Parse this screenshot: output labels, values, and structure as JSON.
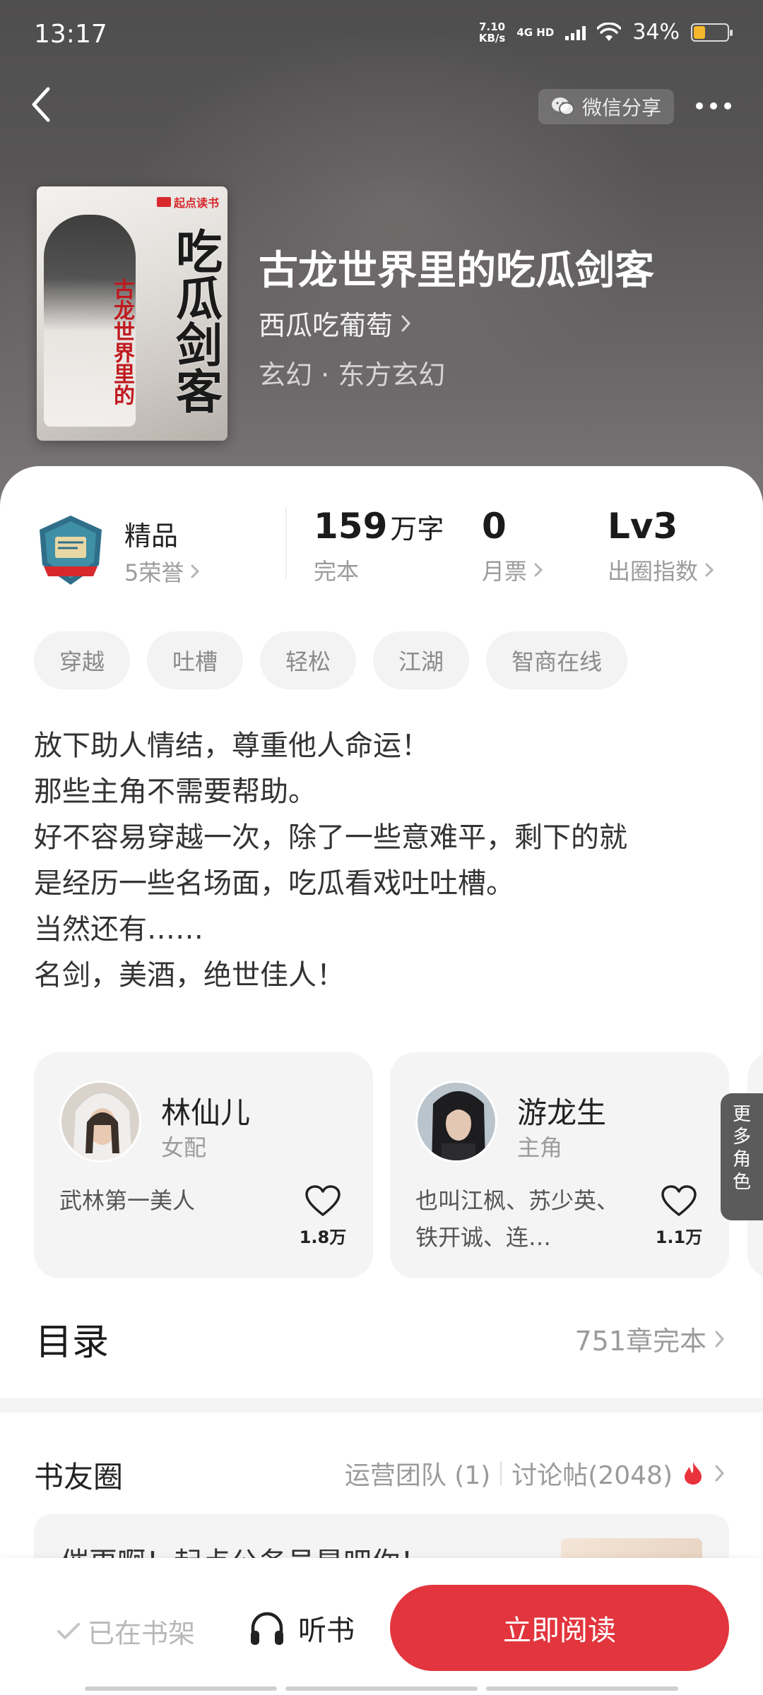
{
  "status_bar": {
    "time": "13:17",
    "net_speed_value": "7.10",
    "net_speed_unit": "KB/s",
    "network": "4G HD",
    "battery": "34%",
    "battery_level": 0.34
  },
  "header": {
    "share_label": "微信分享"
  },
  "book": {
    "cover": {
      "publisher_tag": "起点读书",
      "title_big": "吃瓜剑客",
      "title_red": "古龙世界里的"
    },
    "title": "古龙世界里的吃瓜剑客",
    "author": "西瓜吃葡萄",
    "genre": "玄幻 · 东方玄幻"
  },
  "stats": {
    "honor": {
      "title": "精品",
      "sub": "5荣誉"
    },
    "words": {
      "num": "159",
      "unit": "万字",
      "label": "完本"
    },
    "monthly": {
      "num": "0",
      "label": "月票"
    },
    "influence": {
      "num": "Lv3",
      "label": "出圈指数"
    }
  },
  "tags": [
    "穿越",
    "吐槽",
    "轻松",
    "江湖",
    "智商在线"
  ],
  "intro": [
    "放下助人情结，尊重他人命运！",
    "那些主角不需要帮助。",
    "好不容易穿越一次，除了一些意难平，剩下的就",
    "是经历一些名场面，吃瓜看戏吐吐槽。",
    "当然还有……",
    "名剑，美酒，绝世佳人！"
  ],
  "characters": [
    {
      "name": "林仙儿",
      "role": "女配",
      "desc": "武林第一美人",
      "likes": "1.8万"
    },
    {
      "name": "游龙生",
      "role": "主角",
      "desc": "也叫江枫、苏少英、铁开诚、连…",
      "likes": "1.1万"
    }
  ],
  "more_roles_label": "更多角色",
  "toc": {
    "title": "目录",
    "info": "751章完本"
  },
  "circle": {
    "title": "书友圈",
    "team": "运营团队 (1)",
    "posts": "讨论帖(2048)",
    "preview": "催更啊！起点公务员是吧你！"
  },
  "bottom_bar": {
    "on_shelf": "已在书架",
    "listen": "听书",
    "read": "立即阅读"
  },
  "colors": {
    "accent": "#e2353d",
    "battery": "#f5b72b",
    "fire": "#e8323c"
  }
}
